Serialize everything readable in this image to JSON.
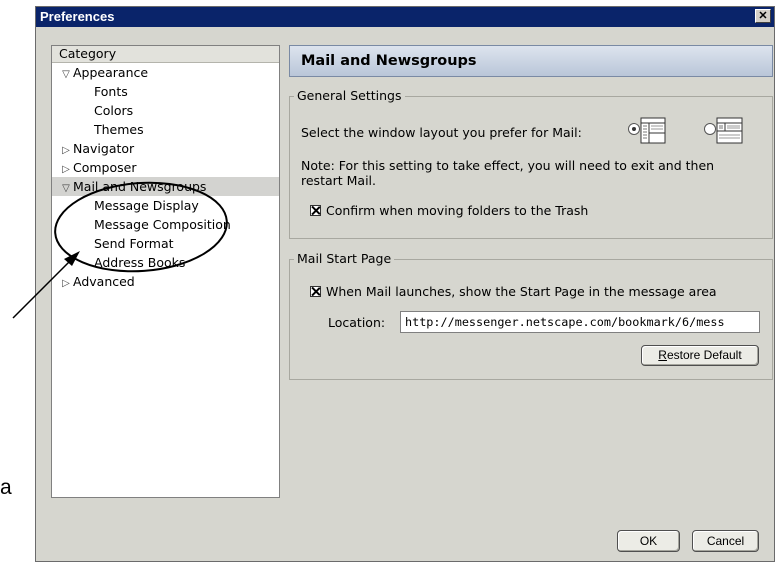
{
  "window": {
    "title": "Preferences",
    "close_glyph": "✕"
  },
  "category": {
    "header": "Category",
    "items": [
      {
        "label": "Appearance",
        "twisty": "▽"
      },
      {
        "label": "Fonts"
      },
      {
        "label": "Colors"
      },
      {
        "label": "Themes"
      },
      {
        "label": "Navigator",
        "twisty": "▷"
      },
      {
        "label": "Composer",
        "twisty": "▷"
      },
      {
        "label": "Mail and Newsgroups",
        "twisty": "▽"
      },
      {
        "label": "Message Display"
      },
      {
        "label": "Message Composition"
      },
      {
        "label": "Send Format"
      },
      {
        "label": "Address Books"
      },
      {
        "label": "Advanced",
        "twisty": "▷"
      }
    ]
  },
  "panel": {
    "title": "Mail and Newsgroups",
    "general": {
      "legend": "General Settings",
      "layout_prompt": "Select the window layout you prefer for Mail:",
      "note_line1": "Note: For this setting to take effect, you will need to exit and then",
      "note_line2": "restart Mail.",
      "confirm_trash": "Confirm when moving folders to the Trash"
    },
    "start_page": {
      "legend": "Mail Start Page",
      "show_start_page": "When Mail launches, show the Start Page in the message area",
      "location_label": "Location:",
      "location_value": "http://messenger.netscape.com/bookmark/6/mess",
      "restore_rest": "estore Default",
      "restore_key": "R"
    }
  },
  "buttons": {
    "ok": "OK",
    "cancel": "Cancel"
  },
  "annotation": {
    "margin_letter": "a"
  }
}
